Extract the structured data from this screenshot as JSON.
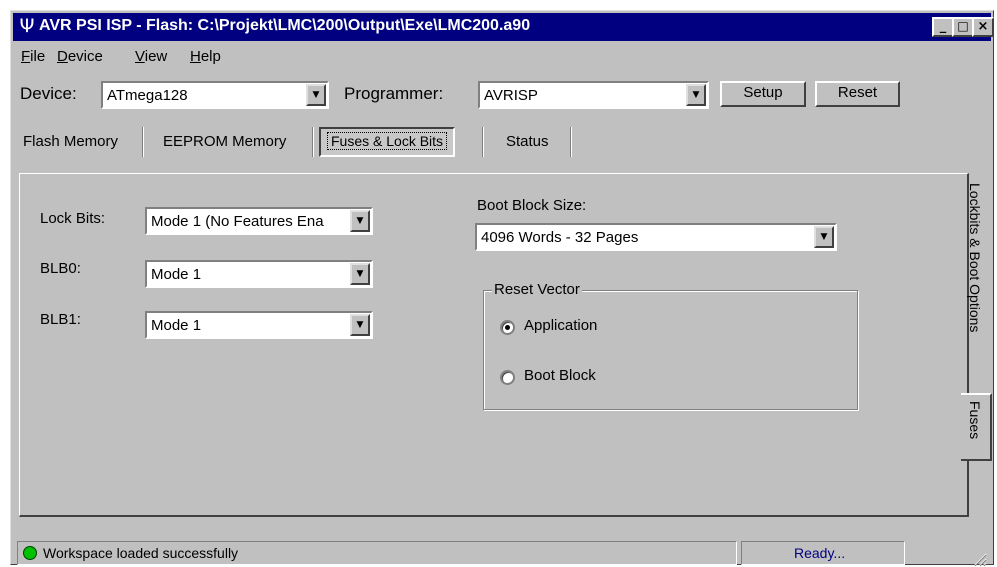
{
  "window": {
    "title": "AVR PSI ISP - Flash: C:\\Projekt\\LMC\\200\\Output\\Exe\\LMC200.a90",
    "icon": "psi-icon",
    "controls": {
      "minimize": "_",
      "maximize": "□",
      "close": "×"
    }
  },
  "menu": {
    "file": {
      "key": "F",
      "rest": "ile"
    },
    "device": {
      "key": "D",
      "rest": "evice"
    },
    "view": {
      "key": "V",
      "rest": "iew"
    },
    "help": {
      "key": "H",
      "rest": "elp"
    }
  },
  "toolbar": {
    "device_label": "Device:",
    "device_value": "ATmega128",
    "programmer_label": "Programmer:",
    "programmer_value": "AVRISP",
    "setup_label": "Setup",
    "reset_label": "Reset"
  },
  "tabs": [
    "Flash Memory",
    "EEPROM Memory",
    "Fuses & Lock Bits",
    "Status"
  ],
  "active_tab": "Fuses & Lock Bits",
  "side_tabs": {
    "lockbits": "Lockbits & Boot Options",
    "fuses": "Fuses"
  },
  "lockbits": {
    "lock_bits_label": "Lock Bits:",
    "lock_bits_value": "Mode 1 (No Features Ena",
    "blb0_label": "BLB0:",
    "blb0_value": "Mode 1",
    "blb1_label": "BLB1:",
    "blb1_value": "Mode 1"
  },
  "boot": {
    "size_label": "Boot Block Size:",
    "size_value": "4096 Words - 32 Pages",
    "reset_vector_title": "Reset Vector",
    "option_application": "Application",
    "option_boot_block": "Boot Block",
    "selected": "Application"
  },
  "status": {
    "message": "Workspace loaded successfully",
    "state": "Ready...",
    "led_color": "#00c000"
  },
  "colors": {
    "title_bar": "#000080",
    "face": "#c0c0c0",
    "ready_text": "#000080"
  }
}
